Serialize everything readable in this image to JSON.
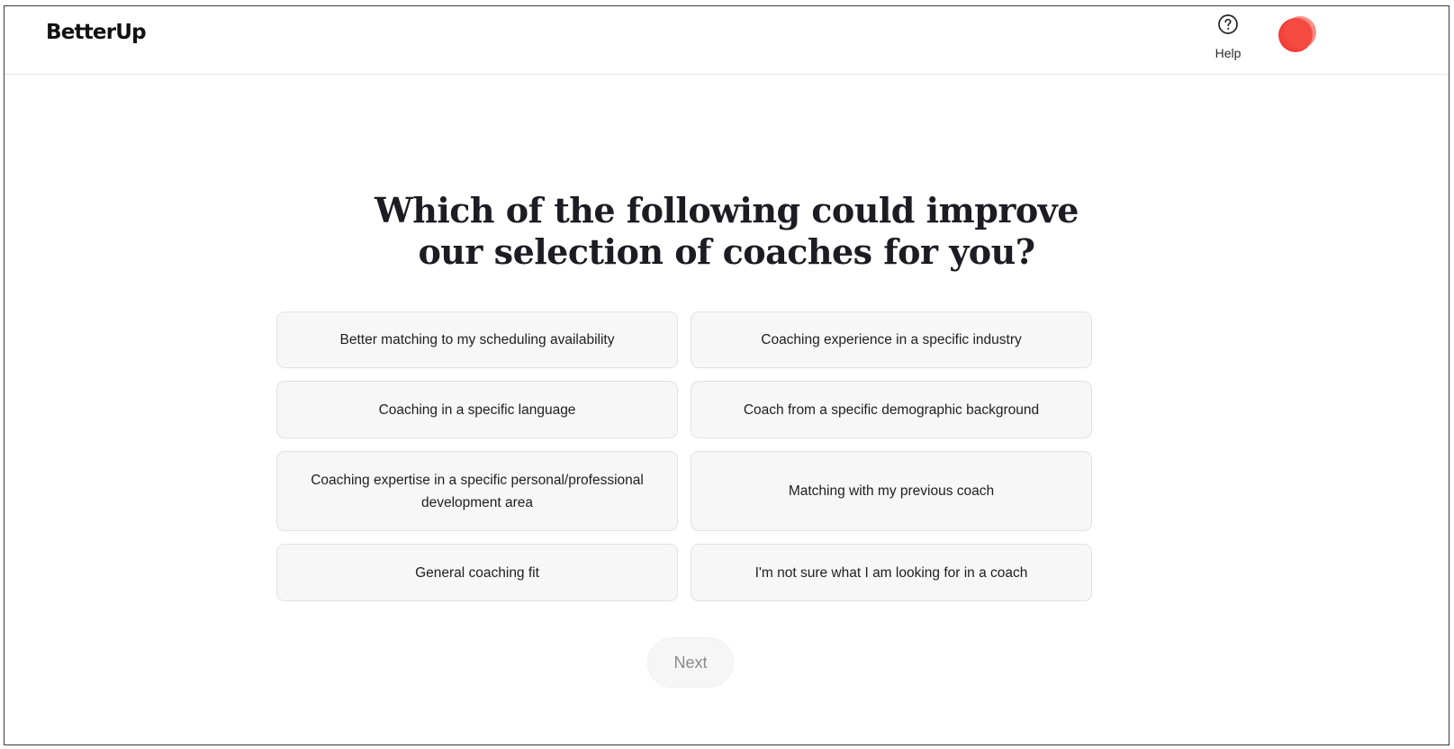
{
  "header": {
    "logo": "BetterUp",
    "help_label": "Help",
    "help_icon": "question-circle-icon",
    "avatar_color": "#f4473e"
  },
  "main": {
    "question_line1": "Which of the following could improve",
    "question_line2": "our selection of coaches for you?",
    "options": [
      {
        "label": "Better matching to my scheduling availability"
      },
      {
        "label": "Coaching experience in a specific industry"
      },
      {
        "label": "Coaching in a specific language"
      },
      {
        "label": "Coach from a specific demographic background"
      },
      {
        "label": "Coaching expertise in a specific personal/professional development area"
      },
      {
        "label": "Matching with my previous coach"
      },
      {
        "label": "General coaching fit"
      },
      {
        "label": "I'm not sure what I am looking for in a coach"
      }
    ],
    "next_label": "Next"
  }
}
